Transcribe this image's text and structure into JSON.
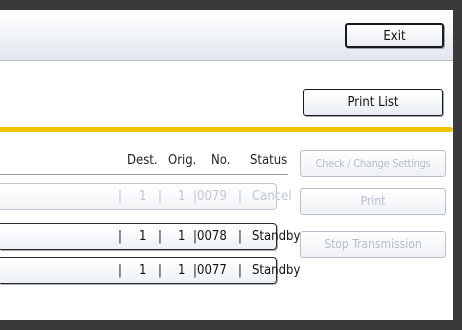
{
  "header": {
    "exit_label": "Exit"
  },
  "toolbar": {
    "print_list_label": "Print List"
  },
  "table": {
    "columns": {
      "dest": "Dest.",
      "orig": "Orig.",
      "no": "No.",
      "status": "Status"
    },
    "rows": [
      {
        "dest": "1",
        "orig": "1",
        "no": "0079",
        "status": "Cancel",
        "disabled": true
      },
      {
        "dest": "1",
        "orig": "1",
        "no": "0078",
        "status": "Standby",
        "disabled": false
      },
      {
        "dest": "1",
        "orig": "1",
        "no": "0077",
        "status": "Standby",
        "disabled": false
      }
    ]
  },
  "actions": {
    "check_change_label": "Check / Change Settings",
    "print_label": "Print",
    "stop_label": "Stop Transmission"
  },
  "colors": {
    "accent_bar": "#f0c400",
    "frame": "#3a3a3a",
    "disabled_text": "#b7bec8"
  }
}
